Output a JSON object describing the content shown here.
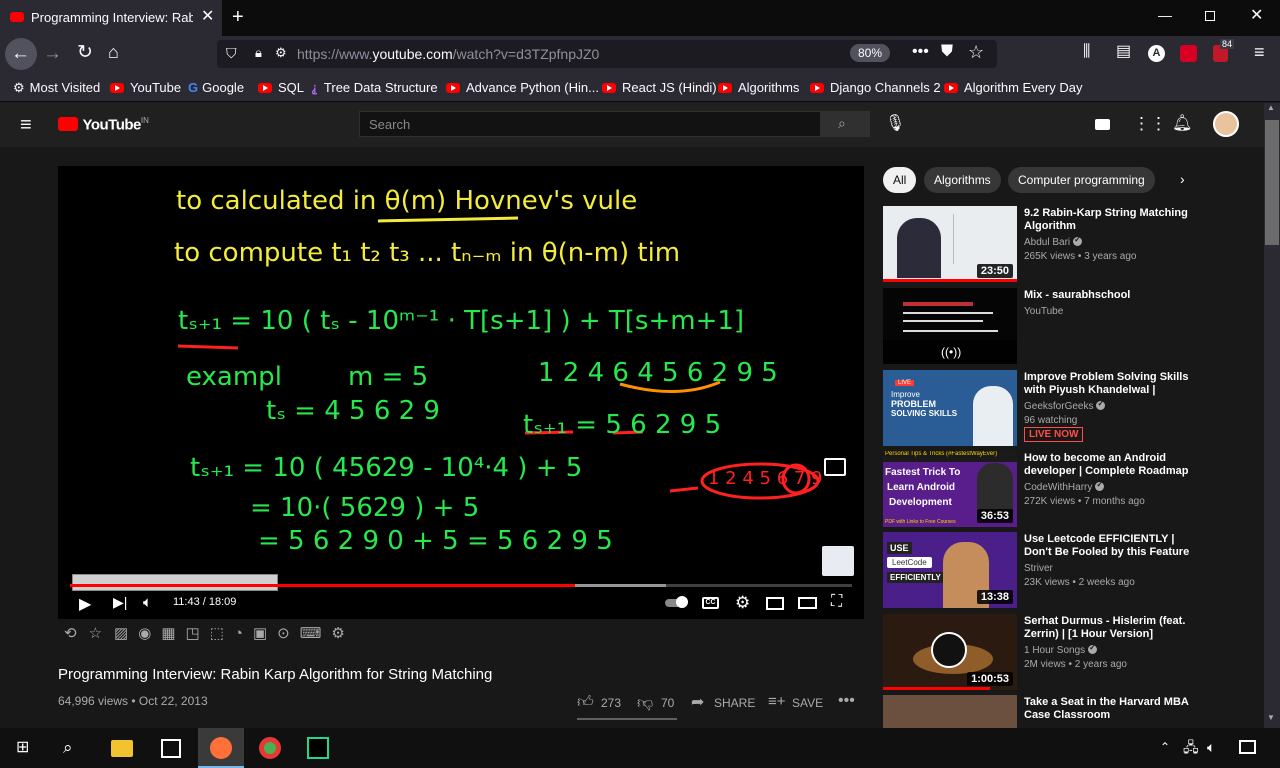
{
  "browser": {
    "tab_title": "Programming Interview: Rabin Karp Algorithm for String Matching",
    "url_prefix": "https://www.",
    "url_domain": "youtube.com",
    "url_path": "/watch?v=d3TZpfnpJZ0",
    "zoom": "80%",
    "badge_count": "84"
  },
  "bookmarks": [
    "Most Visited",
    "YouTube",
    "Google",
    "SQL",
    "Tree Data Structure",
    "Advance Python (Hin...",
    "React JS (Hindi)",
    "Algorithms",
    "Django Channels 2",
    "Algorithm Every Day"
  ],
  "youtube": {
    "logo": "YouTube",
    "region": "IN",
    "search_placeholder": "Search"
  },
  "player": {
    "time": "11:43 / 18:09",
    "progress_fraction": 0.646,
    "buffered_fraction": 0.762,
    "board_lines": [
      "to calculated in θ(m) Hovnev's vule",
      "to compute t₁ t₂ t₃ ... tₙ₋ₘ in θ(n-m) tim",
      "tₛ₊₁ = 10 ( tₛ - 10ᵐ⁻¹ · T[s+1] ) + T[s+m+1]",
      "exampl",
      "m = 5",
      "1 2 4 6 4 5 6 2 9 5",
      "tₛ = 4 5 6 2 9",
      "tₛ₊₁ = 5 6 2 9 5",
      "tₛ₊₁ = 10 ( 45629 - 10⁴·4 ) + 5",
      "= 10·( 5629 ) + 5",
      "= 5 6 2 9 0 + 5 = 5 6 2 9 5",
      "1 2 4 5 6 7 9"
    ]
  },
  "video": {
    "title": "Programming Interview: Rabin Karp Algorithm for String Matching",
    "views_date": "64,996 views • Oct 22, 2013",
    "likes": "273",
    "dislikes": "70",
    "share": "SHARE",
    "save": "SAVE"
  },
  "chips": [
    "All",
    "Algorithms",
    "Computer programming"
  ],
  "recommendations": [
    {
      "title": "9.2 Rabin-Karp String Matching Algorithm",
      "channel": "Abdul Bari",
      "meta": "265K views • 3 years ago",
      "duration": "23:50",
      "verified": true,
      "watched_fraction": 1.0
    },
    {
      "title": "Mix - saurabhschool",
      "channel": "YouTube",
      "meta": "",
      "duration": "",
      "verified": false,
      "watched_fraction": 0
    },
    {
      "title": "Improve Problem Solving Skills with Piyush Khandelwal | GeeksforGeeks",
      "channel": "GeeksforGeeks",
      "meta": "96 watching",
      "duration": "",
      "verified": true,
      "live": "LIVE NOW",
      "watched_fraction": 0
    },
    {
      "title": "How to become an Android developer | Complete Roadmap",
      "channel": "CodeWithHarry",
      "meta": "272K views • 7 months ago",
      "duration": "36:53",
      "verified": true,
      "watched_fraction": 0
    },
    {
      "title": "Use Leetcode EFFICIENTLY | Don't Be Fooled by this Feature",
      "channel": "Striver",
      "meta": "23K views • 2 weeks ago",
      "duration": "13:38",
      "verified": false,
      "watched_fraction": 0
    },
    {
      "title": "Serhat Durmus - Hislerim (feat. Zerrin) | [1 Hour Version]",
      "channel": "1 Hour Songs",
      "meta": "2M views • 2 years ago",
      "duration": "1:00:53",
      "verified": true,
      "watched_fraction": 0.8
    },
    {
      "title": "Take a Seat in the Harvard MBA Case Classroom",
      "channel": "",
      "meta": "",
      "duration": "",
      "verified": false,
      "watched_fraction": 0
    }
  ],
  "thumb_text": {
    "gfg_badge": "LIVE",
    "gfg_line1": "Improve",
    "gfg_line2": "PROBLEM",
    "gfg_line3": "SOLVING SKILLS",
    "harry_banner": "Personal Tips & Tricks (#FastestWayEver)",
    "harry_line1": "Fastest Trick To",
    "harry_line2": "Learn Android",
    "harry_line3": "Development",
    "harry_footer": "PDF with Links to Free Courses",
    "leet_use": "USE",
    "leet_code": "LeetCode",
    "leet_eff": "EFFICIENTLY"
  },
  "colors": {
    "chalk_yellow": "#f4ec3a",
    "chalk_green": "#27e84c",
    "chalk_red": "#ff2020",
    "yt_red": "#ff0000"
  }
}
